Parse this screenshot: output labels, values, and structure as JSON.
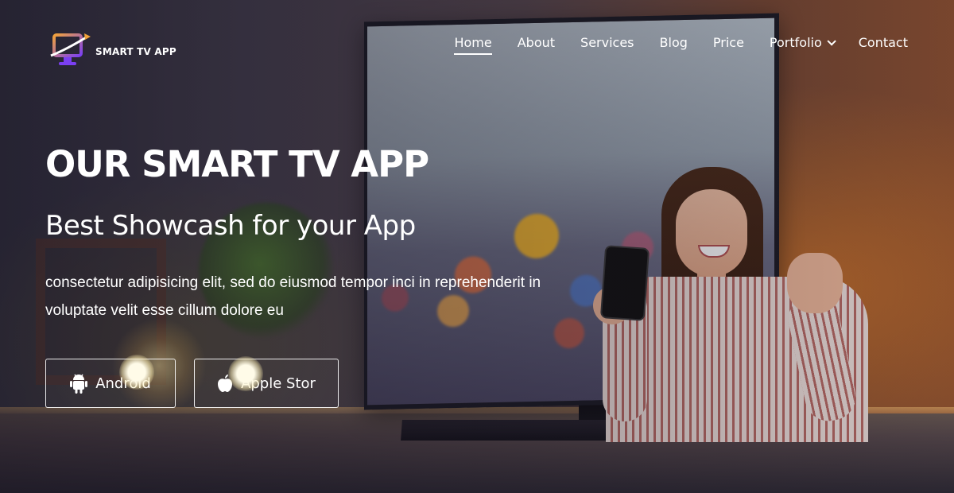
{
  "header": {
    "logo_text": "SMART TV APP",
    "nav": [
      {
        "label": "Home",
        "active": true
      },
      {
        "label": "About"
      },
      {
        "label": "Services"
      },
      {
        "label": "Blog"
      },
      {
        "label": "Price"
      },
      {
        "label": "Portfolio",
        "dropdown": true
      },
      {
        "label": "Contact"
      }
    ]
  },
  "hero": {
    "title": "OUR SMART TV APP",
    "subtitle": "Best Showcash for your App",
    "description": "consectetur adipisicing elit, sed do eiusmod tempor inci in reprehenderit in voluptate velit esse cillum dolore eu",
    "buttons": {
      "android": {
        "label": "Android",
        "icon": "android-icon"
      },
      "apple": {
        "label": "Apple Stor",
        "icon": "apple-icon"
      }
    }
  },
  "colors": {
    "text": "#ffffff",
    "logo_gradient_start": "#f2a33a",
    "logo_gradient_end": "#7b3ff2"
  }
}
